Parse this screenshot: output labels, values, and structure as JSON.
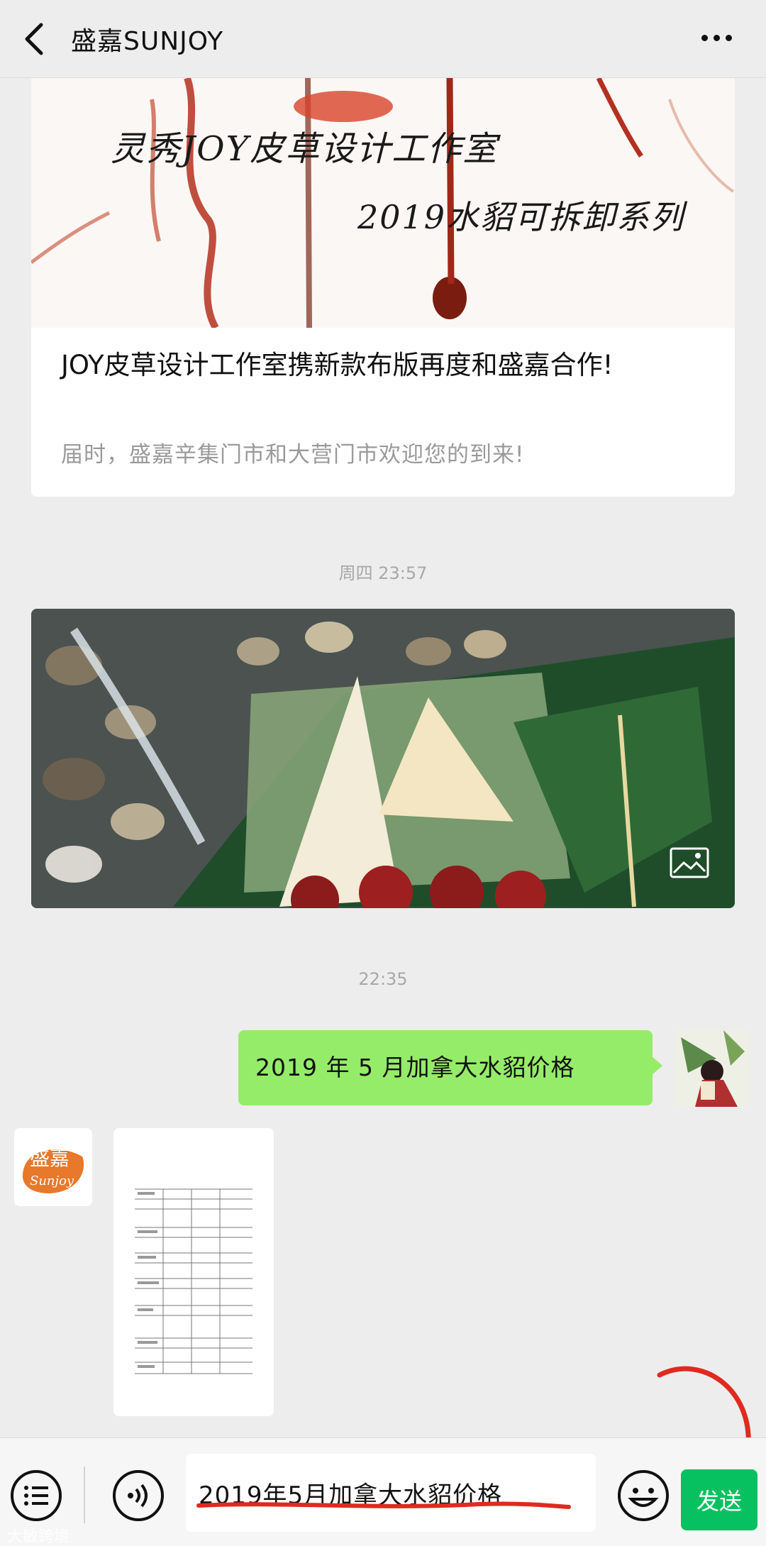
{
  "header": {
    "title": "盛嘉SUNJOY"
  },
  "article": {
    "cover_line1": "灵秀JOY皮草设计工作室",
    "cover_line2": "2019水貂可拆卸系列",
    "title": "JOY皮草设计工作室携新款布版再度和盛嘉合作!",
    "description": "届时，盛嘉辛集门市和大营门市欢迎您的到来!"
  },
  "timestamps": {
    "first": "周四 23:57",
    "second": "22:35"
  },
  "messages": {
    "sent_text": "2019 年 5 月加拿大水貂价格"
  },
  "avatars": {
    "company_logo_text": "盛嘉 Sunjoy"
  },
  "input_bar": {
    "input_value": "2019年5月加拿大水貂价格",
    "send_label": "发送"
  },
  "watermark": {
    "text": "大敏跨境"
  },
  "colors": {
    "bubble_green": "#95ec69",
    "send_green": "#07c160",
    "annotation_red": "#e02a1f"
  }
}
